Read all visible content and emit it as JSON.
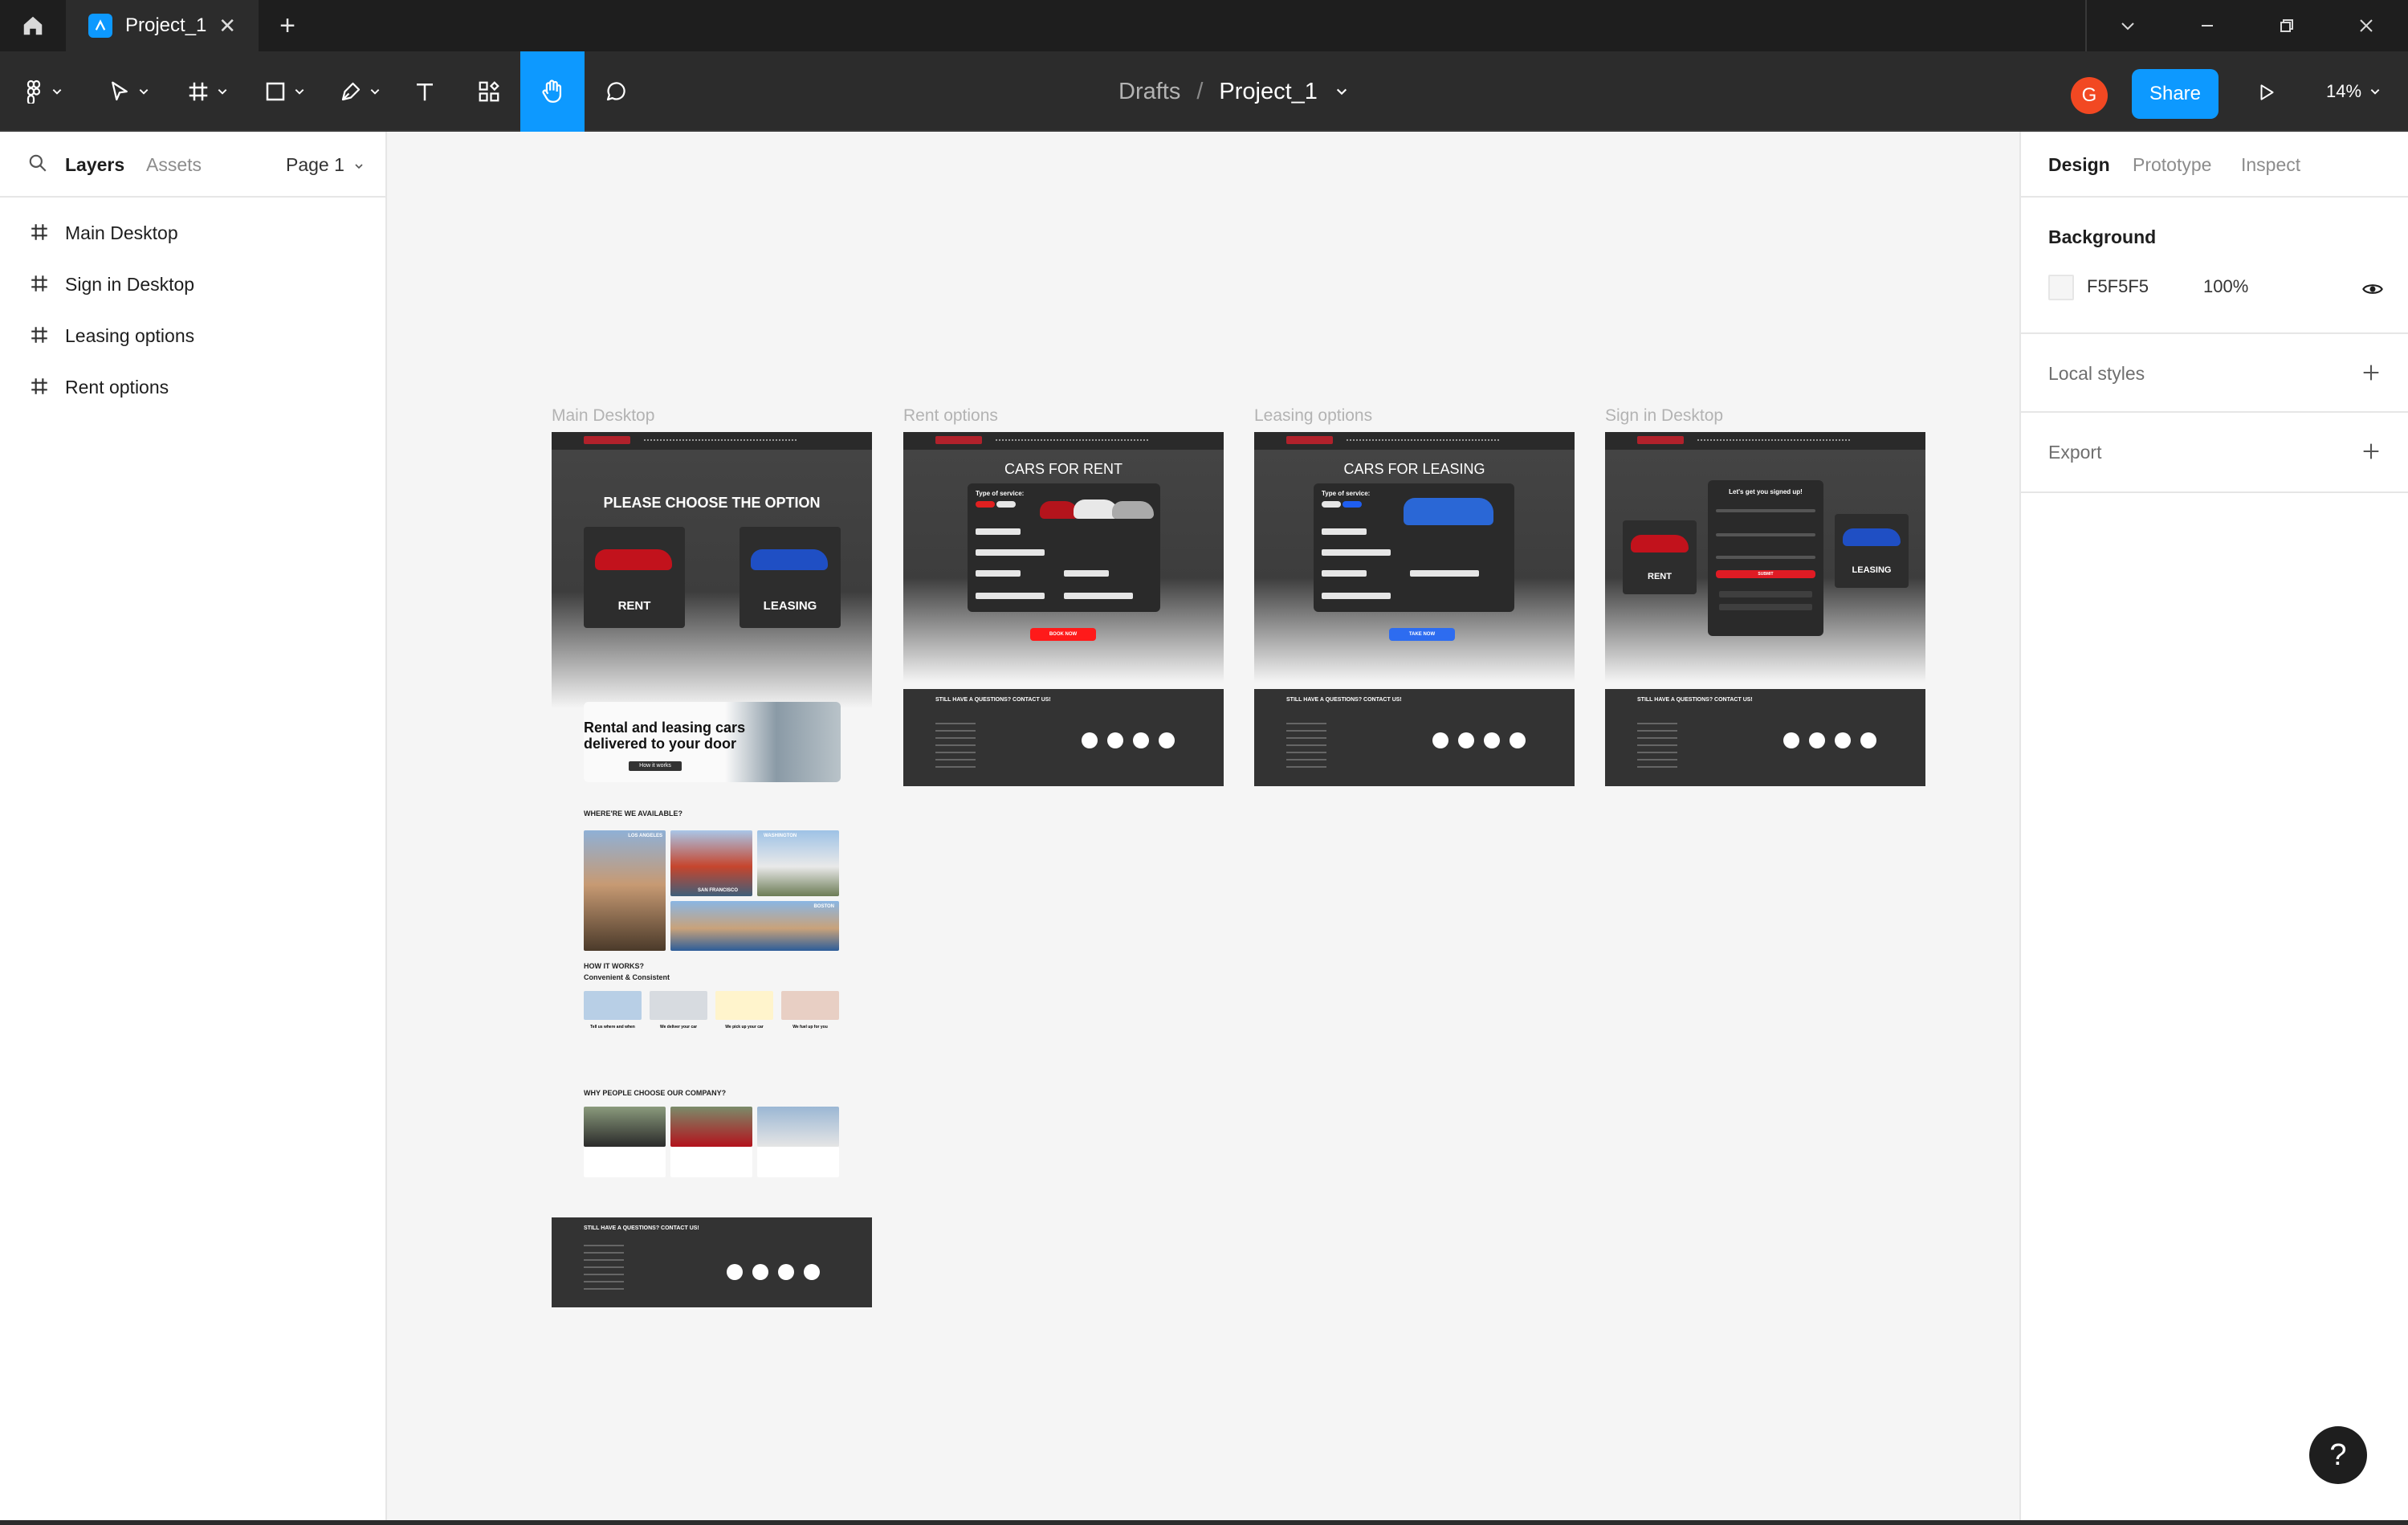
{
  "titlebar": {
    "tab_title": "Project_1",
    "add_tab": "+",
    "close": "✕"
  },
  "toolbar": {
    "breadcrumb_drafts": "Drafts",
    "breadcrumb_sep": "/",
    "project_name": "Project_1",
    "avatar_initial": "G",
    "share_label": "Share",
    "zoom_level": "14%",
    "active_tool": "hand-tool"
  },
  "left_panel": {
    "tabs": {
      "layers": "Layers",
      "assets": "Assets"
    },
    "page_selector": "Page 1",
    "layers": [
      {
        "label": "Main Desktop"
      },
      {
        "label": "Sign in Desktop"
      },
      {
        "label": "Leasing options"
      },
      {
        "label": "Rent options"
      }
    ]
  },
  "canvas": {
    "frames": [
      {
        "label": "Main Desktop",
        "hero_title": "PLEASE CHOOSE THE OPTION",
        "card_rent": "RENT",
        "card_leasing": "LEASING",
        "promo_text": "Rental and leasing cars delivered to your door",
        "promo_button": "How it works",
        "section_available": "WHERE'RE WE AVAILABLE?",
        "cities": [
          "LOS ANGELES",
          "SAN FRANCISCO",
          "WASHINGTON",
          "BOSTON"
        ],
        "section_how": "HOW IT WORKS?",
        "section_how_sub": "Convenient & Consistent",
        "steps": [
          "Tell us where and when",
          "We deliver your car",
          "We pick up your car",
          "We fuel up for you"
        ],
        "section_why": "WHY PEOPLE CHOOSE OUR COMPANY?",
        "footer_title": "STILL HAVE A QUESTIONS? CONTACT US!"
      },
      {
        "label": "Rent options",
        "hero_title": "CARS FOR RENT",
        "form_heading": "Type of service:",
        "button": "BOOK NOW",
        "footer_title": "STILL HAVE A QUESTIONS? CONTACT US!"
      },
      {
        "label": "Leasing options",
        "hero_title": "CARS FOR LEASING",
        "form_heading": "Type of service:",
        "button": "TAKE NOW",
        "footer_title": "STILL HAVE A QUESTIONS? CONTACT US!"
      },
      {
        "label": "Sign in Desktop",
        "form_heading": "Let's get you signed up!",
        "card_rent": "RENT",
        "card_leasing": "LEASING",
        "button": "SUBMIT",
        "footer_title": "STILL HAVE A QUESTIONS? CONTACT US!"
      }
    ]
  },
  "right_panel": {
    "tabs": {
      "design": "Design",
      "prototype": "Prototype",
      "inspect": "Inspect"
    },
    "background_heading": "Background",
    "background_hex": "F5F5F5",
    "background_opacity": "100%",
    "local_styles": "Local styles",
    "export": "Export"
  },
  "help_label": "?",
  "colors": {
    "accent": "#0d99ff",
    "avatar": "#f24822",
    "brand_red": "#c9202c",
    "dark_bar": "#1e1e1e"
  }
}
